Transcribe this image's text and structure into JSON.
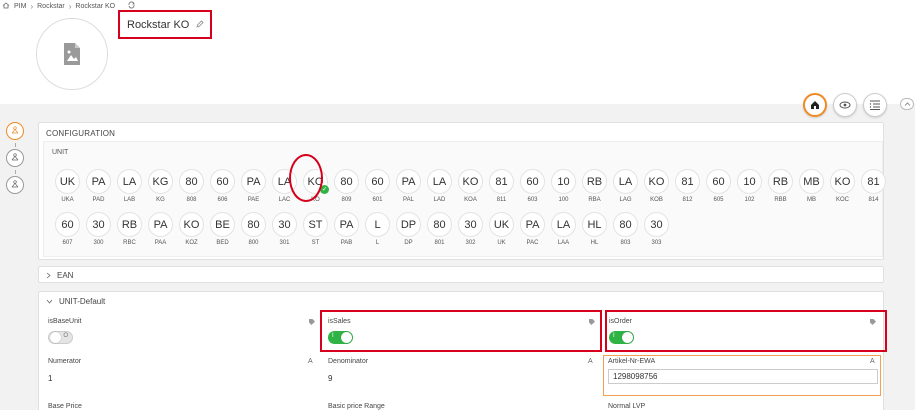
{
  "breadcrumb": {
    "items": [
      "PIM",
      "Rockstar",
      "Rockstar KO"
    ]
  },
  "product": {
    "title": "Rockstar KO"
  },
  "config": {
    "title": "CONFIGURATION",
    "unit_label": "UNIT",
    "row1": [
      {
        "label": "UK",
        "code": "UKA"
      },
      {
        "label": "PA",
        "code": "PAD"
      },
      {
        "label": "LA",
        "code": "LAB"
      },
      {
        "label": "KG",
        "code": "KG"
      },
      {
        "label": "80",
        "code": "808"
      },
      {
        "label": "60",
        "code": "606"
      },
      {
        "label": "PA",
        "code": "PAE"
      },
      {
        "label": "LA",
        "code": "LAC"
      },
      {
        "label": "KO",
        "code": "KO",
        "selected": true
      },
      {
        "label": "80",
        "code": "809"
      },
      {
        "label": "60",
        "code": "601"
      },
      {
        "label": "PA",
        "code": "PAL"
      },
      {
        "label": "LA",
        "code": "LAD"
      },
      {
        "label": "KO",
        "code": "KOA"
      },
      {
        "label": "81",
        "code": "811"
      },
      {
        "label": "60",
        "code": "603"
      },
      {
        "label": "10",
        "code": "100"
      },
      {
        "label": "RB",
        "code": "RBA"
      },
      {
        "label": "LA",
        "code": "LAG"
      },
      {
        "label": "KO",
        "code": "KOB"
      },
      {
        "label": "81",
        "code": "812"
      },
      {
        "label": "60",
        "code": "605"
      },
      {
        "label": "10",
        "code": "102"
      },
      {
        "label": "RB",
        "code": "RBB"
      },
      {
        "label": "MB",
        "code": "MB"
      },
      {
        "label": "KO",
        "code": "KOC"
      },
      {
        "label": "81",
        "code": "814"
      }
    ],
    "row2": [
      {
        "label": "60",
        "code": "607"
      },
      {
        "label": "30",
        "code": "300"
      },
      {
        "label": "RB",
        "code": "RBC"
      },
      {
        "label": "PA",
        "code": "PAA"
      },
      {
        "label": "KO",
        "code": "KOZ"
      },
      {
        "label": "BE",
        "code": "BED"
      },
      {
        "label": "80",
        "code": "800"
      },
      {
        "label": "30",
        "code": "301"
      },
      {
        "label": "ST",
        "code": "ST"
      },
      {
        "label": "PA",
        "code": "PAB"
      },
      {
        "label": "L",
        "code": "L"
      },
      {
        "label": "DP",
        "code": "DP"
      },
      {
        "label": "80",
        "code": "801"
      },
      {
        "label": "30",
        "code": "302"
      },
      {
        "label": "UK",
        "code": "UK"
      },
      {
        "label": "PA",
        "code": "PAC"
      },
      {
        "label": "LA",
        "code": "LAA"
      },
      {
        "label": "HL",
        "code": "HL"
      },
      {
        "label": "80",
        "code": "803"
      },
      {
        "label": "30",
        "code": "303"
      }
    ]
  },
  "ean": {
    "title": "EAN"
  },
  "unit_default": {
    "title": "UNIT-Default",
    "is_base_unit": {
      "label": "isBaseUnit",
      "toggle_text": "O",
      "on": false
    },
    "is_sales": {
      "label": "isSales",
      "toggle_text": "I",
      "on": true
    },
    "is_order": {
      "label": "isOrder",
      "toggle_text": "I",
      "on": true
    },
    "numerator": {
      "label": "Numerator",
      "value": "1"
    },
    "denominator": {
      "label": "Denominator",
      "value": "9"
    },
    "artikel": {
      "label": "Artikel-Nr-EWA",
      "value": "1298098756"
    },
    "base_price": {
      "label": "Base Price"
    },
    "basic_price_range": {
      "label": "Basic price Range"
    },
    "normal_lvp": {
      "label": "Normal LVP"
    }
  },
  "colors": {
    "accent": "#f08a24",
    "highlight": "#d6001c",
    "toggle_on": "#2fb344"
  }
}
